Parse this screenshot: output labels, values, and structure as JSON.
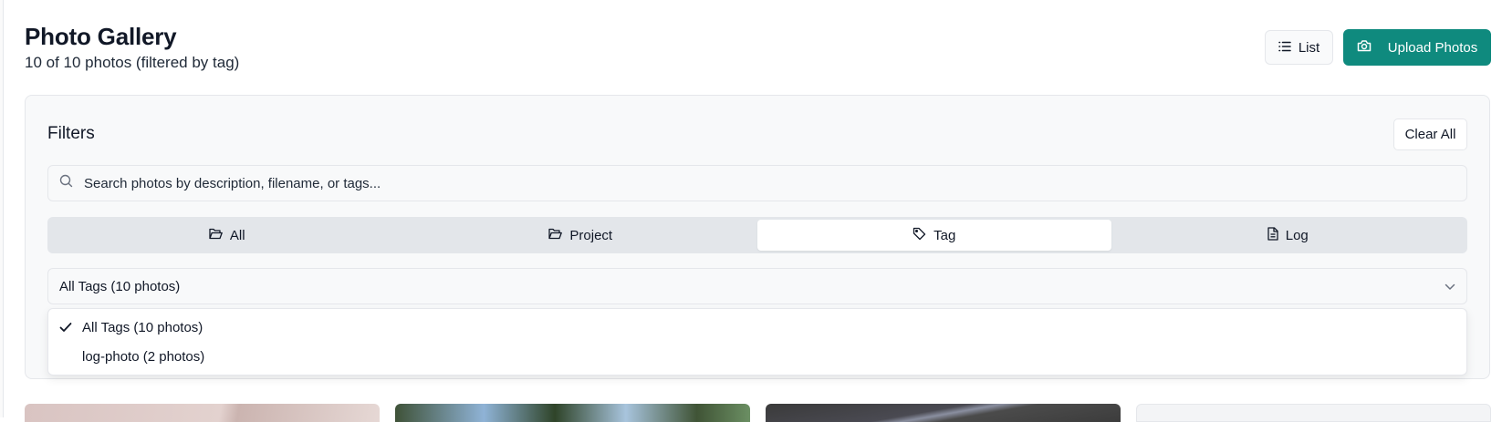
{
  "header": {
    "title": "Photo Gallery",
    "subtitle": "10 of 10 photos (filtered by tag)",
    "list_button": {
      "label": "List",
      "icon": "list-icon"
    },
    "upload_button": {
      "label": "Upload Photos",
      "icon": "camera-icon"
    }
  },
  "filters": {
    "title": "Filters",
    "clear_label": "Clear All",
    "search": {
      "placeholder": "Search photos by description, filename, or tags...",
      "value": "",
      "icon": "search-icon"
    },
    "tabs": [
      {
        "label": "All",
        "icon": "folder-open-icon",
        "active": false
      },
      {
        "label": "Project",
        "icon": "folder-open-icon",
        "active": false
      },
      {
        "label": "Tag",
        "icon": "tag-icon",
        "active": true
      },
      {
        "label": "Log",
        "icon": "file-text-icon",
        "active": false
      }
    ],
    "tag_select": {
      "selected": "All Tags (10 photos)",
      "icon": "chevron-down-icon",
      "options": [
        {
          "label": "All Tags (10 photos)",
          "selected": true
        },
        {
          "label": "log-photo (2 photos)",
          "selected": false
        }
      ]
    }
  },
  "colors": {
    "accent": "#0f8a7e",
    "panel_background": "#f8f9fa",
    "tabs_background": "#e3e6ea",
    "border": "#e5e7eb"
  }
}
